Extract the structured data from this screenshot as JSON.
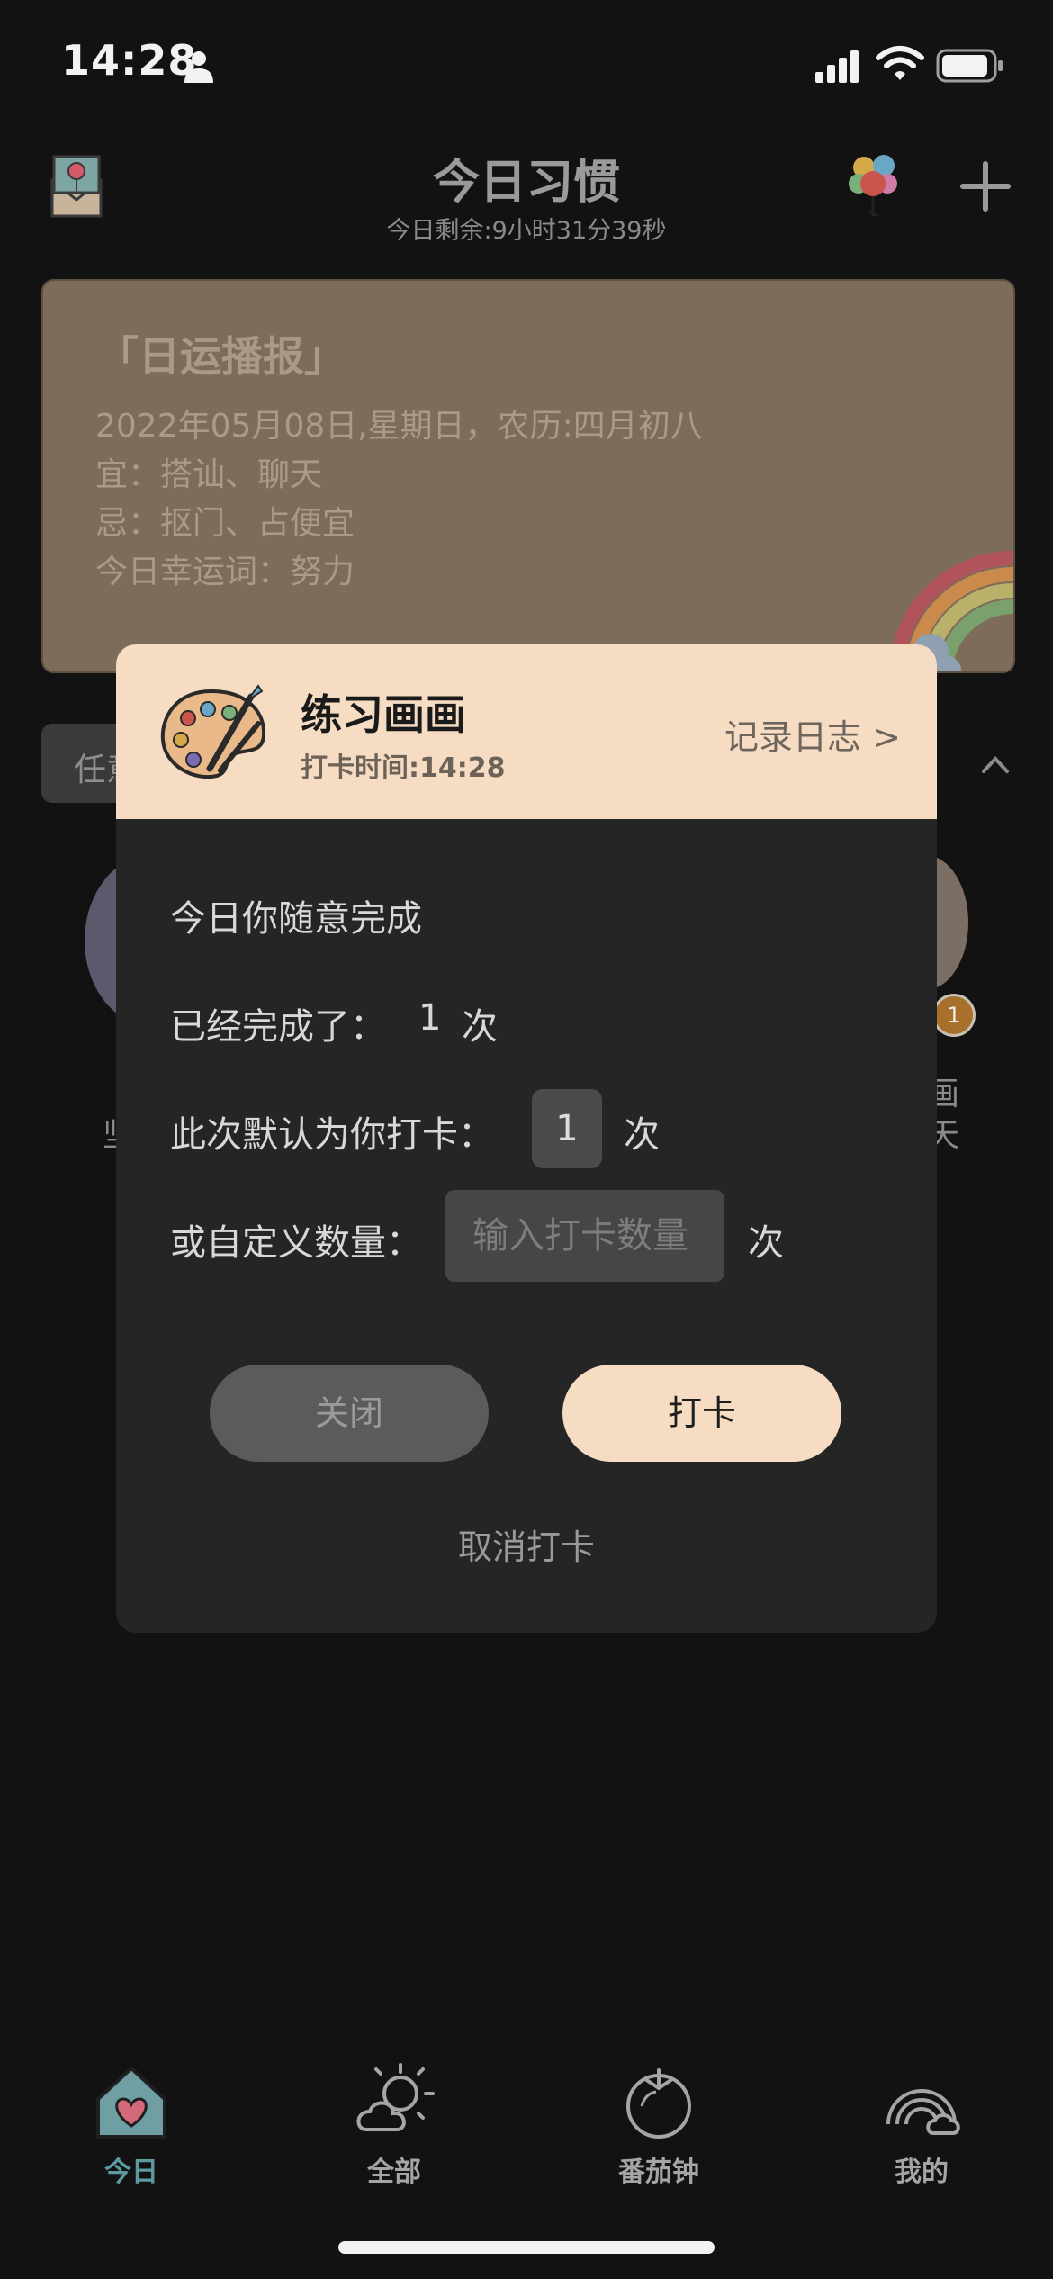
{
  "status_bar": {
    "time": "14:28"
  },
  "header": {
    "title": "今日习惯",
    "subtitle": "今日剩余:9小时31分39秒"
  },
  "fortune": {
    "title": "「日运播报」",
    "lines": [
      "2022年05月08日,星期日，农历:四月初八",
      "宜：搭讪、聊天",
      "忌：抠门、占便宜",
      "今日幸运词：努力"
    ]
  },
  "background": {
    "tab_label": "任意",
    "badge_count": "1",
    "glyph_left": "坚",
    "glyph_right_1": "画",
    "glyph_right_2": "天"
  },
  "modal": {
    "habit_name": "练习画画",
    "checkin_time": "打卡时间:14:28",
    "journal_link": "记录日志  >",
    "line1": "今日你随意完成",
    "done_label": "已经完成了：",
    "done_count": "1",
    "times_unit": "次",
    "default_label": "此次默认为你打卡：",
    "default_count": "1",
    "custom_label": "或自定义数量：",
    "custom_placeholder": "输入打卡数量",
    "close_button": "关闭",
    "checkin_button": "打卡",
    "cancel_link": "取消打卡"
  },
  "nav": {
    "items": [
      {
        "label": "今日",
        "icon": "house-heart-icon",
        "active": true
      },
      {
        "label": "全部",
        "icon": "sun-cloud-icon",
        "active": false
      },
      {
        "label": "番茄钟",
        "icon": "tomato-icon",
        "active": false
      },
      {
        "label": "我的",
        "icon": "rainbow-icon",
        "active": false
      }
    ]
  },
  "colors": {
    "background": "#121212",
    "fortune_card": "#7d6c59",
    "modal_bg": "#252525",
    "accent_peach": "#f6dcc3",
    "nav_active": "#5c9aa0"
  }
}
